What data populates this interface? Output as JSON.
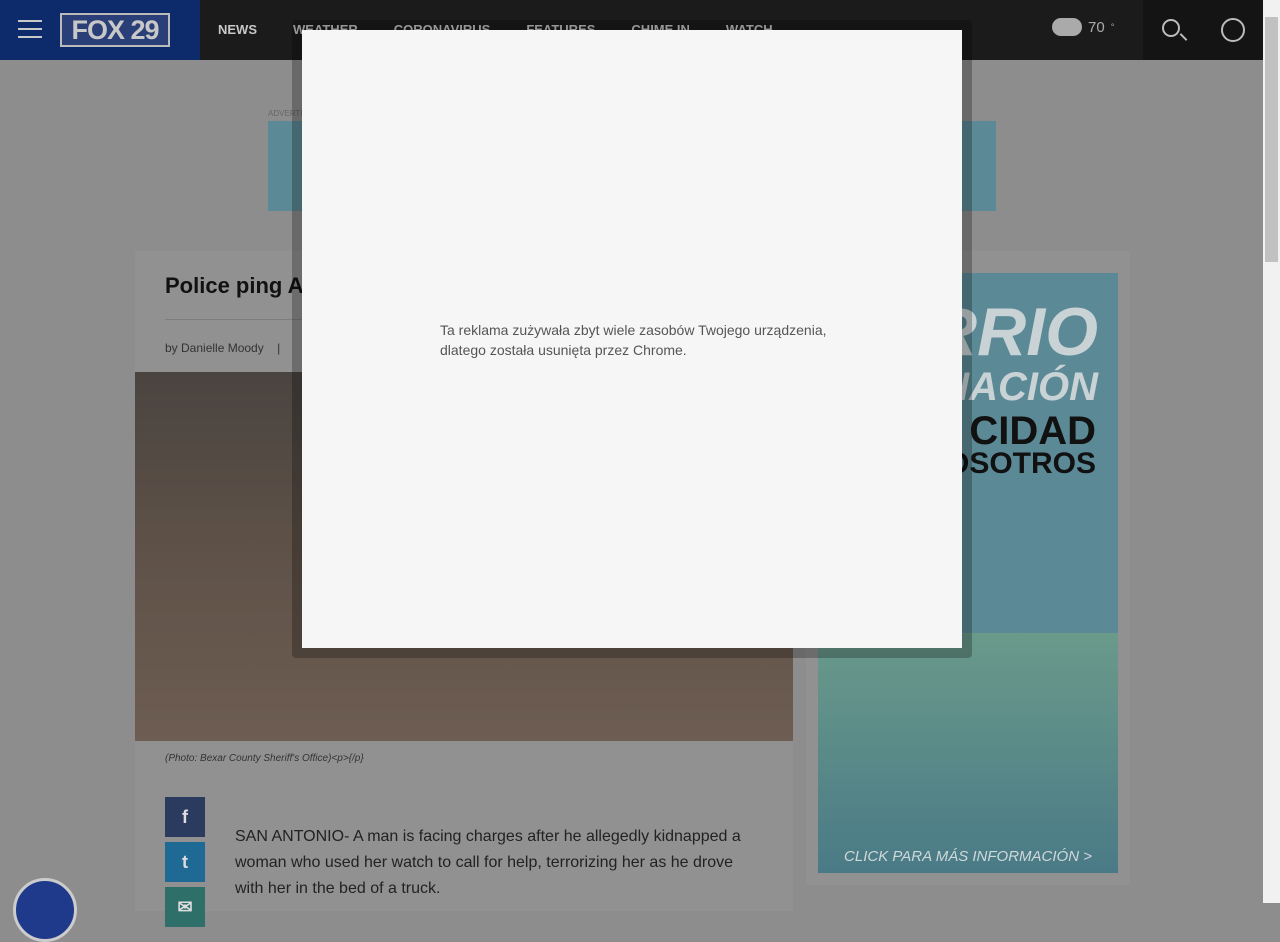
{
  "nav": {
    "logo": "FOX 29",
    "items": [
      "NEWS",
      "WEATHER",
      "CORONAVIRUS",
      "FEATURES",
      "CHIME IN",
      "WATCH"
    ],
    "temperature": "70",
    "degree": "°"
  },
  "ad": {
    "label": "ADVERTISEMENT"
  },
  "article": {
    "title": "Police ping A",
    "byline": "by Danielle Moody",
    "separator": "|",
    "caption": "(Photo: Bexar County Sheriff's Office)<p>{/p}",
    "body": "SAN ANTONIO- A man is facing charges after he allegedly kidnapped a woman who used her watch to call for help, terrorizing her as he drove with her in the bed of a truck."
  },
  "share": {
    "facebook": "f",
    "twitter": "t",
    "email": "✉"
  },
  "side_ad": {
    "line1": "RRIO",
    "line2": "NACIÓN",
    "line3": "CIDAD",
    "line4": "OSOTROS",
    "cta": "CLICK PARA MÁS INFORMACIÓN >"
  },
  "popup": {
    "message": "Ta reklama zużywała zbyt wiele zasobów Twojego urządzenia, dlatego została usunięta przez Chrome."
  }
}
